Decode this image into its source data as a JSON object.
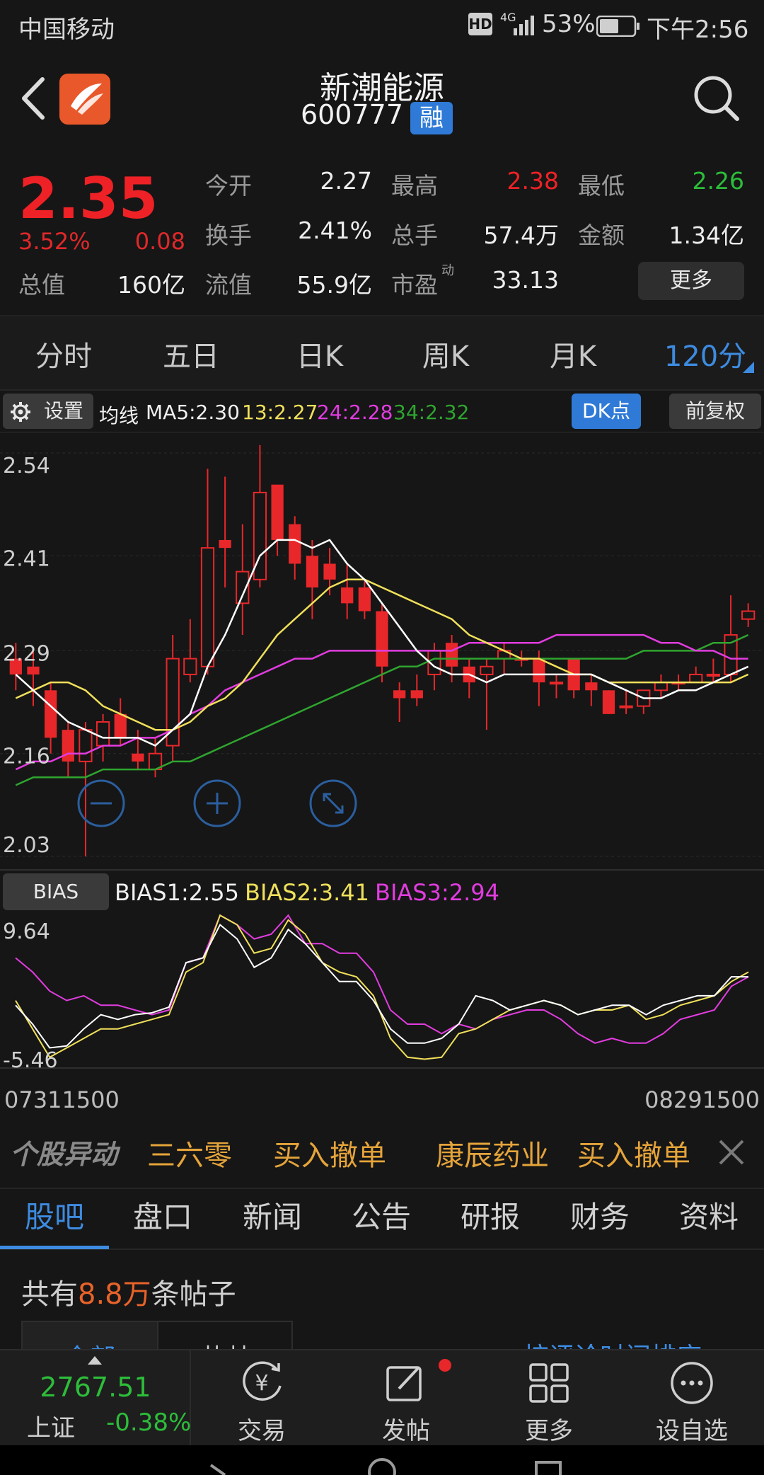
{
  "status_bar": {
    "carrier": "中国移动",
    "hd": "HD",
    "network": "4G",
    "battery_pct": "53%",
    "time": "下午2:56"
  },
  "header": {
    "stock_name": "新潮能源",
    "stock_code": "600777",
    "margin_badge": "融"
  },
  "quote": {
    "price": "2.35",
    "change_pct": "3.52%",
    "change_amt": "0.08",
    "total_value_label": "总值",
    "total_value": "160亿",
    "items": [
      {
        "label": "今开",
        "value": "2.27"
      },
      {
        "label": "最高",
        "value": "2.38"
      },
      {
        "label": "最低",
        "value": "2.26"
      },
      {
        "label": "换手",
        "value": "2.41%"
      },
      {
        "label": "总手",
        "value": "57.4万"
      },
      {
        "label": "金额",
        "value": "1.34亿"
      },
      {
        "label": "流值",
        "value": "55.9亿"
      },
      {
        "label": "市盈",
        "value": "33.13",
        "sup": "动"
      }
    ],
    "more_label": "更多"
  },
  "period_tabs": [
    {
      "label": "分时"
    },
    {
      "label": "五日"
    },
    {
      "label": "日K"
    },
    {
      "label": "周K"
    },
    {
      "label": "月K"
    },
    {
      "label": "120分",
      "active": true
    }
  ],
  "ma_bar": {
    "settings_label": "设置",
    "ma_label": "均线",
    "ma5": "MA5:2.30",
    "ma13": "13:2.27",
    "ma24": "24:2.28",
    "ma34": "34:2.32",
    "dk_label": "DK点",
    "adjust_label": "前复权"
  },
  "chart_data": {
    "type": "candlestick",
    "y_ticks": [
      "2.54",
      "2.41",
      "2.29",
      "2.16",
      "2.03"
    ],
    "ylim": [
      2.03,
      2.54
    ],
    "x_range": [
      "07311500",
      "08291500"
    ],
    "colors": {
      "up": "#e8272a",
      "down": "#e8272a",
      "ma5": "#ffffff",
      "ma13": "#f0e05a",
      "ma24": "#e23ce0",
      "ma34": "#2fa52f"
    },
    "candles": [
      {
        "o": 2.28,
        "c": 2.26,
        "h": 2.3,
        "l": 2.24
      },
      {
        "o": 2.27,
        "c": 2.26,
        "h": 2.29,
        "l": 2.22
      },
      {
        "o": 2.24,
        "c": 2.18,
        "h": 2.25,
        "l": 2.16
      },
      {
        "o": 2.19,
        "c": 2.15,
        "h": 2.2,
        "l": 2.13
      },
      {
        "o": 2.15,
        "c": 2.19,
        "h": 2.2,
        "l": 2.03
      },
      {
        "o": 2.17,
        "c": 2.2,
        "h": 2.21,
        "l": 2.15
      },
      {
        "o": 2.21,
        "c": 2.18,
        "h": 2.23,
        "l": 2.17
      },
      {
        "o": 2.16,
        "c": 2.15,
        "h": 2.19,
        "l": 2.14
      },
      {
        "o": 2.14,
        "c": 2.16,
        "h": 2.18,
        "l": 2.13
      },
      {
        "o": 2.17,
        "c": 2.28,
        "h": 2.31,
        "l": 2.15
      },
      {
        "o": 2.26,
        "c": 2.28,
        "h": 2.33,
        "l": 2.25
      },
      {
        "o": 2.27,
        "c": 2.42,
        "h": 2.52,
        "l": 2.26
      },
      {
        "o": 2.43,
        "c": 2.42,
        "h": 2.51,
        "l": 2.37
      },
      {
        "o": 2.35,
        "c": 2.39,
        "h": 2.45,
        "l": 2.31
      },
      {
        "o": 2.38,
        "c": 2.49,
        "h": 2.55,
        "l": 2.37
      },
      {
        "o": 2.5,
        "c": 2.43,
        "h": 2.5,
        "l": 2.41
      },
      {
        "o": 2.45,
        "c": 2.4,
        "h": 2.46,
        "l": 2.38
      },
      {
        "o": 2.41,
        "c": 2.37,
        "h": 2.43,
        "l": 2.33
      },
      {
        "o": 2.4,
        "c": 2.38,
        "h": 2.42,
        "l": 2.36
      },
      {
        "o": 2.37,
        "c": 2.35,
        "h": 2.4,
        "l": 2.33
      },
      {
        "o": 2.37,
        "c": 2.34,
        "h": 2.38,
        "l": 2.33
      },
      {
        "o": 2.34,
        "c": 2.27,
        "h": 2.35,
        "l": 2.25
      },
      {
        "o": 2.24,
        "c": 2.23,
        "h": 2.25,
        "l": 2.2
      },
      {
        "o": 2.24,
        "c": 2.23,
        "h": 2.26,
        "l": 2.22
      },
      {
        "o": 2.26,
        "c": 2.29,
        "h": 2.3,
        "l": 2.24
      },
      {
        "o": 2.3,
        "c": 2.27,
        "h": 2.31,
        "l": 2.25
      },
      {
        "o": 2.27,
        "c": 2.25,
        "h": 2.28,
        "l": 2.23
      },
      {
        "o": 2.26,
        "c": 2.27,
        "h": 2.28,
        "l": 2.19
      },
      {
        "o": 2.28,
        "c": 2.29,
        "h": 2.3,
        "l": 2.26
      },
      {
        "o": 2.28,
        "c": 2.28,
        "h": 2.29,
        "l": 2.27
      },
      {
        "o": 2.28,
        "c": 2.25,
        "h": 2.29,
        "l": 2.22
      },
      {
        "o": 2.25,
        "c": 2.25,
        "h": 2.26,
        "l": 2.23
      },
      {
        "o": 2.28,
        "c": 2.24,
        "h": 2.28,
        "l": 2.23
      },
      {
        "o": 2.25,
        "c": 2.24,
        "h": 2.26,
        "l": 2.22
      },
      {
        "o": 2.24,
        "c": 2.21,
        "h": 2.24,
        "l": 2.21
      },
      {
        "o": 2.22,
        "c": 2.22,
        "h": 2.24,
        "l": 2.21
      },
      {
        "o": 2.22,
        "c": 2.24,
        "h": 2.24,
        "l": 2.21
      },
      {
        "o": 2.24,
        "c": 2.25,
        "h": 2.26,
        "l": 2.23
      },
      {
        "o": 2.25,
        "c": 2.25,
        "h": 2.26,
        "l": 2.24
      },
      {
        "o": 2.25,
        "c": 2.26,
        "h": 2.27,
        "l": 2.25
      },
      {
        "o": 2.26,
        "c": 2.26,
        "h": 2.28,
        "l": 2.25
      },
      {
        "o": 2.26,
        "c": 2.31,
        "h": 2.36,
        "l": 2.25
      },
      {
        "o": 2.33,
        "c": 2.34,
        "h": 2.35,
        "l": 2.32
      }
    ],
    "ma5": [
      2.26,
      2.24,
      2.22,
      2.2,
      2.19,
      2.18,
      2.18,
      2.18,
      2.17,
      2.19,
      2.21,
      2.27,
      2.31,
      2.36,
      2.41,
      2.43,
      2.43,
      2.42,
      2.43,
      2.4,
      2.38,
      2.35,
      2.32,
      2.29,
      2.27,
      2.26,
      2.26,
      2.25,
      2.26,
      2.26,
      2.26,
      2.26,
      2.26,
      2.26,
      2.25,
      2.24,
      2.23,
      2.23,
      2.24,
      2.24,
      2.25,
      2.26,
      2.27
    ],
    "ma13": [
      2.23,
      2.24,
      2.25,
      2.25,
      2.24,
      2.22,
      2.21,
      2.2,
      2.19,
      2.19,
      2.2,
      2.22,
      2.23,
      2.25,
      2.28,
      2.31,
      2.33,
      2.35,
      2.37,
      2.38,
      2.38,
      2.37,
      2.36,
      2.35,
      2.34,
      2.33,
      2.31,
      2.3,
      2.29,
      2.28,
      2.28,
      2.27,
      2.26,
      2.26,
      2.25,
      2.25,
      2.25,
      2.25,
      2.25,
      2.25,
      2.25,
      2.25,
      2.26
    ],
    "ma24": [
      2.14,
      2.15,
      2.15,
      2.16,
      2.16,
      2.17,
      2.17,
      2.18,
      2.18,
      2.19,
      2.21,
      2.22,
      2.24,
      2.25,
      2.26,
      2.27,
      2.28,
      2.28,
      2.29,
      2.29,
      2.29,
      2.29,
      2.29,
      2.29,
      2.29,
      2.29,
      2.3,
      2.3,
      2.3,
      2.3,
      2.3,
      2.31,
      2.31,
      2.31,
      2.31,
      2.31,
      2.31,
      2.3,
      2.3,
      2.29,
      2.29,
      2.28,
      2.28
    ],
    "ma34": [
      2.12,
      2.13,
      2.13,
      2.13,
      2.13,
      2.14,
      2.14,
      2.14,
      2.14,
      2.15,
      2.15,
      2.16,
      2.17,
      2.18,
      2.19,
      2.2,
      2.21,
      2.22,
      2.23,
      2.24,
      2.25,
      2.26,
      2.27,
      2.27,
      2.28,
      2.28,
      2.28,
      2.28,
      2.28,
      2.28,
      2.28,
      2.28,
      2.28,
      2.28,
      2.28,
      2.28,
      2.29,
      2.29,
      2.29,
      2.29,
      2.3,
      2.3,
      2.31
    ]
  },
  "bias": {
    "label": "BIAS",
    "bias1": "BIAS1:2.55",
    "bias2": "BIAS2:3.41",
    "bias3": "BIAS3:2.94",
    "y_ticks": [
      "9.64",
      "-5.46"
    ],
    "ylim": [
      -5.46,
      9.64
    ],
    "bias1_values": [
      0.5,
      -1.5,
      -4.0,
      -3.8,
      -2.0,
      -0.5,
      -1.0,
      -0.5,
      -0.3,
      0.3,
      5.0,
      5.5,
      9.0,
      7.5,
      4.5,
      5.5,
      8.5,
      7.0,
      5.0,
      3.0,
      3.0,
      1.0,
      -2.0,
      -3.5,
      -3.5,
      -3.0,
      -1.5,
      1.5,
      1.0,
      0.0,
      0.5,
      1.0,
      0.5,
      -0.5,
      0.0,
      0.5,
      0.5,
      -0.5,
      0.5,
      1.0,
      1.5,
      1.5,
      3.5,
      3.5
    ],
    "bias2_values": [
      1.0,
      -2.0,
      -5.0,
      -4.0,
      -3.0,
      -2.0,
      -2.0,
      -1.5,
      -1.0,
      -0.5,
      4.0,
      5.0,
      10.0,
      9.0,
      6.0,
      6.5,
      9.5,
      8.0,
      5.0,
      4.0,
      3.5,
      1.5,
      -3.0,
      -5.0,
      -5.2,
      -5.0,
      -2.5,
      -2.0,
      -1.0,
      0.0,
      0.5,
      1.0,
      0.5,
      -0.5,
      0.0,
      0.0,
      0.5,
      -1.0,
      -0.5,
      0.5,
      1.0,
      1.5,
      3.0,
      4.0
    ],
    "bias3_values": [
      5.5,
      4.0,
      2.0,
      1.0,
      1.5,
      0.5,
      0.5,
      0.0,
      -0.5,
      0.0,
      5.0,
      5.5,
      10.0,
      9.0,
      7.5,
      8.0,
      10.0,
      7.0,
      7.0,
      6.0,
      6.0,
      4.0,
      0.0,
      -1.5,
      -1.5,
      -2.5,
      -1.5,
      -2.0,
      -1.0,
      -0.5,
      0.0,
      0.0,
      -1.0,
      -2.5,
      -3.5,
      -3.0,
      -3.5,
      -3.5,
      -2.5,
      -1.0,
      -0.5,
      0.0,
      2.5,
      3.5
    ]
  },
  "dates": {
    "start": "07311500",
    "end": "08291500"
  },
  "ticker": {
    "title": "个股异动",
    "items": [
      "三六零",
      "买入撤单",
      "康辰药业",
      "买入撤单"
    ]
  },
  "content_tabs": [
    {
      "label": "股吧",
      "active": true
    },
    {
      "label": "盘口"
    },
    {
      "label": "新闻"
    },
    {
      "label": "公告"
    },
    {
      "label": "研报"
    },
    {
      "label": "财务"
    },
    {
      "label": "资料"
    }
  ],
  "posts": {
    "prefix": "共有",
    "count": "8.8万",
    "suffix": "条帖子",
    "filter_all": "全部",
    "filter_hot": "热帖",
    "sort": "按评论时间排序"
  },
  "bottom_nav": {
    "index_value": "2767.51",
    "index_name": "上证",
    "index_change": "-0.38%",
    "items": [
      {
        "label": "交易"
      },
      {
        "label": "发帖"
      },
      {
        "label": "更多"
      },
      {
        "label": "设自选"
      }
    ]
  }
}
